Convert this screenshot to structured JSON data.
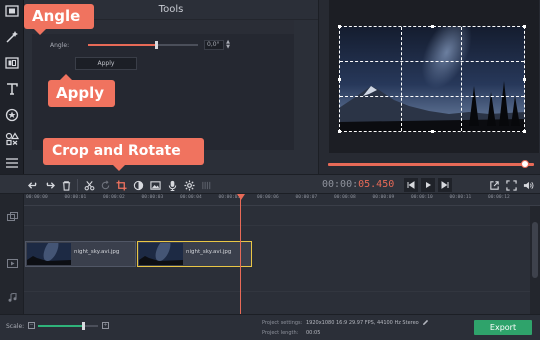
{
  "tools_panel": {
    "title": "Tools",
    "section": "ate",
    "angle_label": "Angle:",
    "angle_value": "0,0°",
    "apply_button": "Apply"
  },
  "callouts": {
    "angle": "Angle",
    "apply": "Apply",
    "crop": "Crop and Rotate"
  },
  "toolbar": {
    "timecode_main": "00:00:",
    "timecode_frac": "05.450"
  },
  "ruler": {
    "ticks": [
      "00:00:00",
      "00:00:01",
      "00:00:02",
      "00:00:03",
      "00:00:04",
      "00:00:05",
      "00:00:06",
      "00:00:07",
      "00:00:08",
      "00:00:09",
      "00:00:10",
      "00:00:11",
      "00:00:12"
    ]
  },
  "clips": [
    {
      "name": "night_sky.avi.jpg"
    },
    {
      "name": "night_sky.avi.jpg"
    }
  ],
  "bottom": {
    "scale_label": "Scale:",
    "project_settings_label": "Project settings:",
    "project_settings_value": "1920x1080 16:9 29.97 FPS, 44100 Hz Stereo",
    "project_length_label": "Project length:",
    "project_length_value": "00:05",
    "export_button": "Export"
  },
  "colors": {
    "accent": "#f0735f",
    "export": "#2fa36b",
    "selection": "#e9c646"
  },
  "preview": {
    "seek_fraction": 0.98
  },
  "scale_fraction": 0.73,
  "angle_fraction": 0.62
}
